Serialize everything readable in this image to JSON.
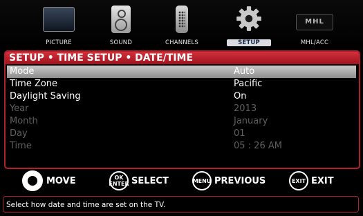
{
  "menu": {
    "tabs": [
      {
        "label": "PICTURE",
        "icon": "picture-icon"
      },
      {
        "label": "SOUND",
        "icon": "speaker-icon"
      },
      {
        "label": "CHANNELS",
        "icon": "remote-icon"
      },
      {
        "label": "SETUP",
        "icon": "gear-icon",
        "active": true
      },
      {
        "label": "MHL/ACC",
        "icon": "mhl-logo-icon",
        "logo_text": "MHL"
      }
    ]
  },
  "panel": {
    "breadcrumb": "SETUP • TIME SETUP • DATE/TIME",
    "rows": [
      {
        "label": "Mode",
        "value": "Auto",
        "state": "selected"
      },
      {
        "label": "Time Zone",
        "value": "Pacific",
        "state": "enabled"
      },
      {
        "label": "Daylight Saving",
        "value": "On",
        "state": "enabled"
      },
      {
        "label": "Year",
        "value": "2013",
        "state": "disabled"
      },
      {
        "label": "Month",
        "value": "January",
        "state": "disabled"
      },
      {
        "label": "Day",
        "value": "01",
        "state": "disabled"
      },
      {
        "label": "Time",
        "value": "05 : 26 AM",
        "state": "disabled"
      }
    ]
  },
  "footer": {
    "move": {
      "label": "MOVE",
      "icon": "dpad-icon"
    },
    "select": {
      "label": "SELECT",
      "button_line1": "OK",
      "button_line2": "ENTER"
    },
    "previous": {
      "label": "PREVIOUS",
      "button": "MENU"
    },
    "exit": {
      "label": "EXIT",
      "button": "EXIT"
    }
  },
  "help_text": "Select how date and time are set on the TV.",
  "colors": {
    "accent_red": "#b21f2d",
    "selected_row": "#a9a9a9",
    "disabled_text": "#5f5f5f"
  }
}
